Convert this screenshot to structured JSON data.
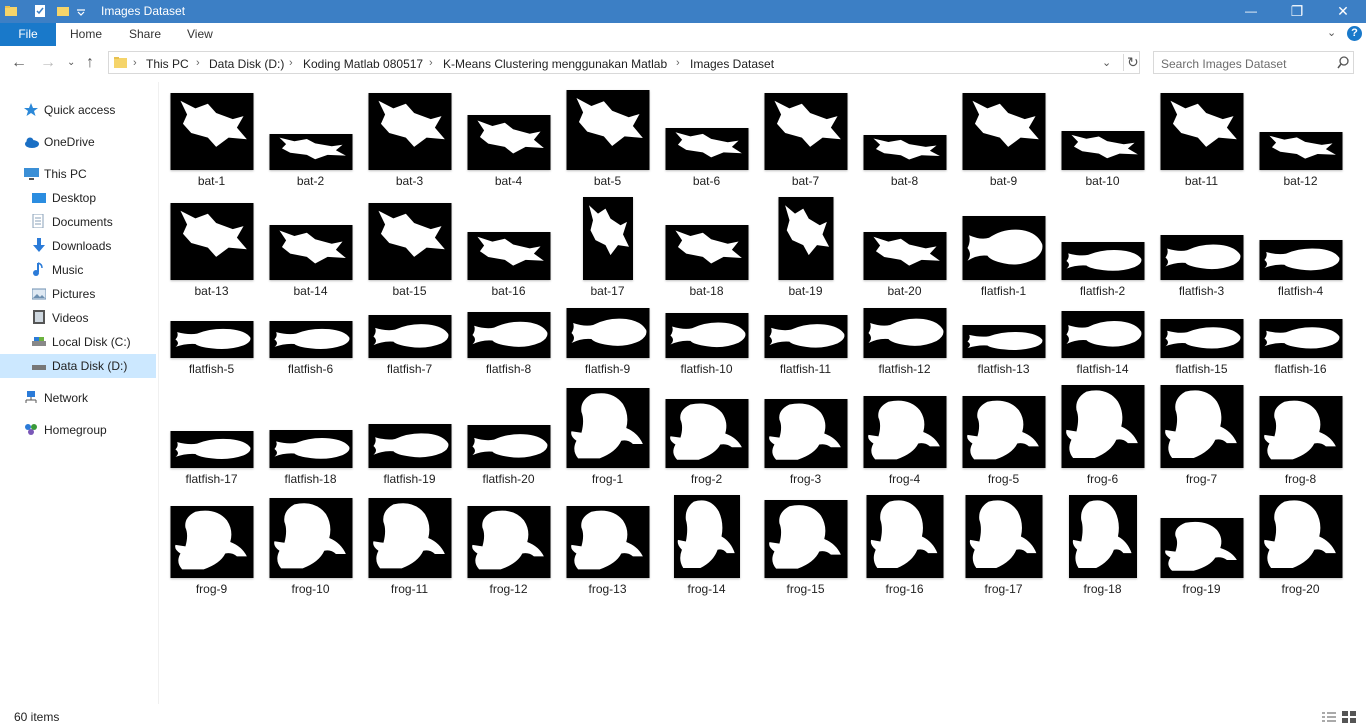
{
  "window": {
    "title": "Images Dataset",
    "minimize": "—",
    "maximize": "❐",
    "close": "✕"
  },
  "ribbon": {
    "file": "File",
    "tabs": [
      "Home",
      "Share",
      "View"
    ]
  },
  "address": {
    "crumbs": [
      "This PC",
      "Data Disk (D:)",
      "Koding Matlab 080517",
      "K-Means Clustering menggunakan Matlab",
      "Images Dataset"
    ],
    "separator": "›"
  },
  "search": {
    "placeholder": "Search Images Dataset"
  },
  "nav": {
    "items": [
      {
        "label": "Quick access",
        "icon": "star-icon",
        "color": "#2b88d8"
      },
      {
        "label": "OneDrive",
        "icon": "cloud-icon",
        "color": "#1a6fc4"
      },
      {
        "label": "This PC",
        "icon": "computer-icon",
        "color": "#3b8fd6"
      },
      {
        "label": "Desktop",
        "icon": "desktop-icon",
        "color": "#2b8de0"
      },
      {
        "label": "Documents",
        "icon": "documents-icon",
        "color": "#8aa2b8"
      },
      {
        "label": "Downloads",
        "icon": "download-icon",
        "color": "#2b7bd8"
      },
      {
        "label": "Music",
        "icon": "music-icon",
        "color": "#2b7bd8"
      },
      {
        "label": "Pictures",
        "icon": "pictures-icon",
        "color": "#6d8fb0"
      },
      {
        "label": "Videos",
        "icon": "videos-icon",
        "color": "#555555"
      },
      {
        "label": "Local Disk (C:)",
        "icon": "drive-icon",
        "color": "#777777"
      },
      {
        "label": "Data Disk (D:)",
        "icon": "drive-icon",
        "color": "#777777"
      },
      {
        "label": "Network",
        "icon": "network-icon",
        "color": "#2b7bd8"
      },
      {
        "label": "Homegroup",
        "icon": "homegroup-icon",
        "color": "#3a9a3a"
      }
    ]
  },
  "files": [
    {
      "name": "bat-1",
      "t": "bat"
    },
    {
      "name": "bat-2",
      "t": "bat"
    },
    {
      "name": "bat-3",
      "t": "bat"
    },
    {
      "name": "bat-4",
      "t": "bat"
    },
    {
      "name": "bat-5",
      "t": "bat"
    },
    {
      "name": "bat-6",
      "t": "bat"
    },
    {
      "name": "bat-7",
      "t": "bat"
    },
    {
      "name": "bat-8",
      "t": "bat"
    },
    {
      "name": "bat-9",
      "t": "bat"
    },
    {
      "name": "bat-10",
      "t": "bat"
    },
    {
      "name": "bat-11",
      "t": "bat"
    },
    {
      "name": "bat-12",
      "t": "bat"
    },
    {
      "name": "bat-13",
      "t": "bat"
    },
    {
      "name": "bat-14",
      "t": "bat"
    },
    {
      "name": "bat-15",
      "t": "bat"
    },
    {
      "name": "bat-16",
      "t": "bat"
    },
    {
      "name": "bat-17",
      "t": "bat"
    },
    {
      "name": "bat-18",
      "t": "bat"
    },
    {
      "name": "bat-19",
      "t": "bat"
    },
    {
      "name": "bat-20",
      "t": "bat"
    },
    {
      "name": "flatfish-1",
      "t": "fish"
    },
    {
      "name": "flatfish-2",
      "t": "fish"
    },
    {
      "name": "flatfish-3",
      "t": "fish"
    },
    {
      "name": "flatfish-4",
      "t": "fish"
    },
    {
      "name": "flatfish-5",
      "t": "fish"
    },
    {
      "name": "flatfish-6",
      "t": "fish"
    },
    {
      "name": "flatfish-7",
      "t": "fish"
    },
    {
      "name": "flatfish-8",
      "t": "fish"
    },
    {
      "name": "flatfish-9",
      "t": "fish"
    },
    {
      "name": "flatfish-10",
      "t": "fish"
    },
    {
      "name": "flatfish-11",
      "t": "fish"
    },
    {
      "name": "flatfish-12",
      "t": "fish"
    },
    {
      "name": "flatfish-13",
      "t": "fish"
    },
    {
      "name": "flatfish-14",
      "t": "fish"
    },
    {
      "name": "flatfish-15",
      "t": "fish"
    },
    {
      "name": "flatfish-16",
      "t": "fish"
    },
    {
      "name": "flatfish-17",
      "t": "fish"
    },
    {
      "name": "flatfish-18",
      "t": "fish"
    },
    {
      "name": "flatfish-19",
      "t": "fish"
    },
    {
      "name": "flatfish-20",
      "t": "fish"
    },
    {
      "name": "frog-1",
      "t": "frog"
    },
    {
      "name": "frog-2",
      "t": "frog"
    },
    {
      "name": "frog-3",
      "t": "frog"
    },
    {
      "name": "frog-4",
      "t": "frog"
    },
    {
      "name": "frog-5",
      "t": "frog"
    },
    {
      "name": "frog-6",
      "t": "frog"
    },
    {
      "name": "frog-7",
      "t": "frog"
    },
    {
      "name": "frog-8",
      "t": "frog"
    },
    {
      "name": "frog-9",
      "t": "frog"
    },
    {
      "name": "frog-10",
      "t": "frog"
    },
    {
      "name": "frog-11",
      "t": "frog"
    },
    {
      "name": "frog-12",
      "t": "frog"
    },
    {
      "name": "frog-13",
      "t": "frog"
    },
    {
      "name": "frog-14",
      "t": "frog"
    },
    {
      "name": "frog-15",
      "t": "frog"
    },
    {
      "name": "frog-16",
      "t": "frog"
    },
    {
      "name": "frog-17",
      "t": "frog"
    },
    {
      "name": "frog-18",
      "t": "frog"
    },
    {
      "name": "frog-19",
      "t": "frog"
    },
    {
      "name": "frog-20",
      "t": "frog"
    }
  ],
  "status": {
    "count": "60 items"
  }
}
